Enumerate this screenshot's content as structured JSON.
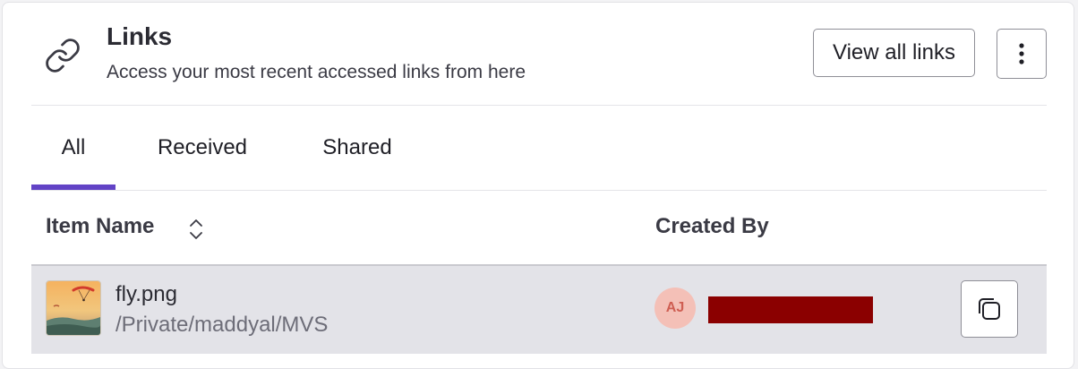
{
  "header": {
    "title": "Links",
    "subtitle": "Access your most recent accessed links from here",
    "view_all_label": "View all links",
    "icon": "link-icon",
    "more_icon": "more-vertical-icon"
  },
  "tabs": [
    {
      "label": "All",
      "active": true
    },
    {
      "label": "Received",
      "active": false
    },
    {
      "label": "Shared",
      "active": false
    }
  ],
  "colors": {
    "accent": "#6243c6",
    "avatar_bg": "#f4c0b7",
    "avatar_text": "#cf5e52",
    "redaction": "#8b0000",
    "row_highlight": "#e3e3e8"
  },
  "table": {
    "columns": [
      {
        "label": "Item Name",
        "sortable": true,
        "sort_icon": "sort-icon"
      },
      {
        "label": "Created By",
        "sortable": false
      }
    ],
    "rows": [
      {
        "name": "fly.png",
        "path": "/Private/maddyal/MVS",
        "thumbnail": "paraglider-sunset-image",
        "creator_initials": "AJ",
        "creator_name_redacted": true,
        "action_icon": "copy-icon"
      }
    ]
  }
}
